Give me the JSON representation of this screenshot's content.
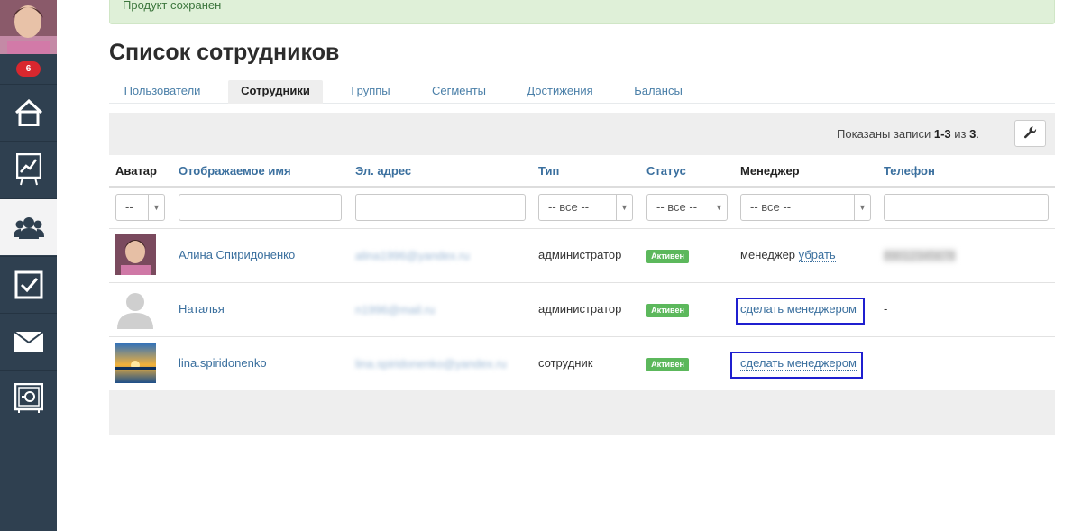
{
  "sidebar": {
    "notification_count": "6",
    "items": [
      {
        "name": "home",
        "icon": "home-icon",
        "active": false
      },
      {
        "name": "stats",
        "icon": "chart-icon",
        "active": false
      },
      {
        "name": "users",
        "icon": "users-icon",
        "active": true
      },
      {
        "name": "tasks",
        "icon": "checkbox-icon",
        "active": false
      },
      {
        "name": "mail",
        "icon": "envelope-icon",
        "active": false
      },
      {
        "name": "safe",
        "icon": "safe-icon",
        "active": false
      }
    ]
  },
  "alert": {
    "text": "Продукт сохранен"
  },
  "page": {
    "title": "Список сотрудников"
  },
  "tabs": [
    {
      "label": "Пользователи",
      "active": false
    },
    {
      "label": "Сотрудники",
      "active": true
    },
    {
      "label": "Группы",
      "active": false
    },
    {
      "label": "Сегменты",
      "active": false
    },
    {
      "label": "Достижения",
      "active": false
    },
    {
      "label": "Балансы",
      "active": false
    }
  ],
  "records": {
    "prefix": "Показаны записи",
    "range": "1-3",
    "of": "из",
    "total": "3",
    "dot": "."
  },
  "columns": {
    "avatar": "Аватар",
    "name": "Отображаемое имя",
    "email": "Эл. адрес",
    "type": "Тип",
    "status": "Статус",
    "manager": "Менеджер",
    "phone": "Телефон"
  },
  "filters": {
    "avatar": "--",
    "type": "-- все --",
    "status": "-- все --",
    "manager": "-- все --"
  },
  "rows": [
    {
      "name": "Алина Спиридоненко",
      "email": "alina1996@yandex.ru",
      "type": "администратор",
      "status": "Активен",
      "manager_text": "менеджер",
      "manager_link": "убрать",
      "phone": "89012345678"
    },
    {
      "name": "Наталья",
      "email": "n1996@mail.ru",
      "type": "администратор",
      "status": "Активен",
      "manager_link": "сделать менеджером",
      "phone": "-"
    },
    {
      "name": "lina.spiridonenko",
      "email": "lina.spiridonenko@yandex.ru",
      "type": "сотрудник",
      "status": "Активен",
      "manager_link": "сделать менеджером",
      "phone": ""
    }
  ],
  "colors": {
    "sidebar": "#2f4050",
    "link": "#3a6f9e",
    "status": "#5cb85c",
    "badge": "#d9272e",
    "highlight": "#1f1fcf"
  }
}
